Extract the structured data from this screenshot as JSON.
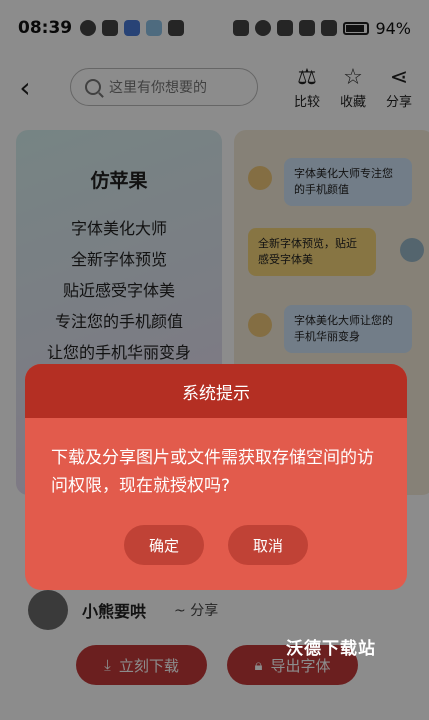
{
  "status_bar": {
    "time": "08:39",
    "battery": "94%"
  },
  "topbar": {
    "search_placeholder": "这里有你想要的",
    "actions": [
      {
        "label": "比较",
        "icon": "balance-scale-icon"
      },
      {
        "label": "收藏",
        "icon": "star-icon"
      },
      {
        "label": "分享",
        "icon": "share-icon"
      }
    ]
  },
  "preview_left": {
    "title": "仿苹果",
    "lines": [
      "字体美化大师",
      "全新字体预览",
      "贴近感受字体美",
      "专注您的手机颜值",
      "让您的手机华丽变身"
    ]
  },
  "preview_right": {
    "bubbles": [
      "字体美化大师专注您的手机颜值",
      "全新字体预览，贴近感受字体美",
      "字体美化大师让您的手机华丽变身"
    ]
  },
  "author": {
    "name": "小熊要哄",
    "share": "~ 分享"
  },
  "bottom_buttons": {
    "download": "立刻下载",
    "export": "导出字体"
  },
  "dialog": {
    "title": "系统提示",
    "message": "下载及分享图片或文件需获取存储空间的访问权限，现在就授权吗?",
    "confirm": "确定",
    "cancel": "取消"
  },
  "watermark": "沃德下载站",
  "colors": {
    "dialog_body": "#e25b4c",
    "dialog_header": "#b42f23",
    "button": "#c04236"
  }
}
